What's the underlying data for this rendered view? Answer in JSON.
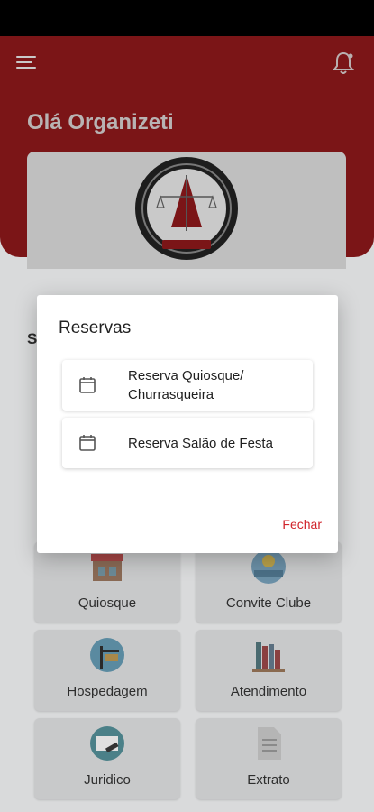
{
  "app": {
    "greeting": "Olá Organizeti"
  },
  "colors": {
    "header": "#7b1517",
    "accent": "#d0232a"
  },
  "section": {
    "partial_title": "S"
  },
  "tiles": [
    {
      "label": "Quiosque",
      "icon": "kiosk-icon"
    },
    {
      "label": "Convite Clube",
      "icon": "beach-icon"
    },
    {
      "label": "Hospedagem",
      "icon": "hotel-sign-icon"
    },
    {
      "label": "Atendimento",
      "icon": "books-icon"
    },
    {
      "label": "Juridico",
      "icon": "legal-icon"
    },
    {
      "label": "Extrato",
      "icon": "document-icon"
    }
  ],
  "dialog": {
    "title": "Reservas",
    "options": [
      {
        "label_line1": "Reserva Quiosque/",
        "label_line2": "Churrasqueira",
        "icon": "calendar-icon"
      },
      {
        "label_line1": "Reserva Salão de Festa",
        "label_line2": "",
        "icon": "calendar-icon"
      }
    ],
    "close_label": "Fechar"
  }
}
